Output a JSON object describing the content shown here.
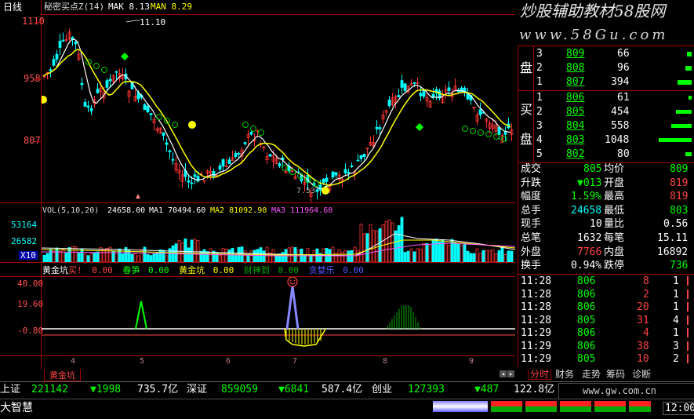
{
  "colors": {
    "up": "#ff3333",
    "down": "#00ffff",
    "bg": "#000000",
    "grid": "#a00000",
    "ma_yellow": "#ffff00",
    "ma_white": "#ffffff"
  },
  "chart_header": {
    "period": "日线",
    "indicator": "秘密买点Z(14)",
    "mak": "MAK 8.13",
    "man": "MAN 8.29"
  },
  "price_axis": [
    "1110",
    "958",
    "807"
  ],
  "high_mark": "11.10",
  "low_mark": "7.53",
  "vol_header": {
    "name": "VOL(5,10,20)",
    "vol": "24658.00",
    "ma1": "MA1 70494.60",
    "ma2": "MA2 81092.90",
    "ma3": "MA3 111964.60"
  },
  "vol_axis": [
    "53164",
    "26582"
  ],
  "vol_unit": "X10",
  "ind_header": {
    "name": "黄金坑",
    "buy": "买!",
    "v1": "0.00",
    "chun": "春笋",
    "v2": "0.00",
    "hjk": "黄金坑",
    "v3": "0.00",
    "caishen": "财神到",
    "v4": "0.00",
    "tan": "贪婪乐",
    "v5": "0.00"
  },
  "ind_axis": [
    "40.00",
    "19.60",
    "-0.80"
  ],
  "months": [
    "4",
    "5",
    "6",
    "7",
    "8",
    "9"
  ],
  "bottom_tab": "黄金坑",
  "watermark_cn": "炒股辅助教材58股网",
  "watermark_url": "www.58Gu.com",
  "order_book": {
    "sell_label": "盘",
    "buy_labels": [
      "买",
      "盘"
    ],
    "asks": [
      {
        "lvl": "3",
        "price": "809",
        "vol": "66"
      },
      {
        "lvl": "2",
        "price": "808",
        "vol": "96"
      },
      {
        "lvl": "1",
        "price": "807",
        "vol": "394"
      }
    ],
    "bids": [
      {
        "lvl": "1",
        "price": "806",
        "vol": "61"
      },
      {
        "lvl": "2",
        "price": "805",
        "vol": "454"
      },
      {
        "lvl": "3",
        "price": "804",
        "vol": "558"
      },
      {
        "lvl": "4",
        "price": "803",
        "vol": "1048"
      },
      {
        "lvl": "5",
        "price": "802",
        "vol": "80"
      }
    ]
  },
  "quote": [
    {
      "l1": "成交",
      "v1": "805",
      "l2": "均价",
      "v2": "809"
    },
    {
      "l1": "升跌",
      "v1": "▼013",
      "l2": "开盘",
      "v2": "819"
    },
    {
      "l1": "幅度",
      "v1": "1.59%",
      "l2": "最高",
      "v2": "819"
    },
    {
      "l1": "总手",
      "v1": "24658",
      "l2": "最低",
      "v2": "803"
    },
    {
      "l1": "现手",
      "v1": "10",
      "l2": "量比",
      "v2": "0.56"
    },
    {
      "l1": "总笔",
      "v1": "1632",
      "l2": "每笔",
      "v2": "15.11"
    },
    {
      "l1": "外盘",
      "v1": "7766",
      "l2": "内盘",
      "v2": "16892"
    },
    {
      "l1": "换手",
      "v1": "0.94%",
      "l2": "跌停",
      "v2": "736"
    }
  ],
  "ticks": [
    {
      "time": "11:28",
      "price": "806",
      "vol": "8",
      "n": "1"
    },
    {
      "time": "11:28",
      "price": "806",
      "vol": "2",
      "n": "1"
    },
    {
      "time": "11:28",
      "price": "806",
      "vol": "20",
      "n": "1"
    },
    {
      "time": "11:28",
      "price": "805",
      "vol": "31",
      "n": "4"
    },
    {
      "time": "11:29",
      "price": "806",
      "vol": "4",
      "n": "1"
    },
    {
      "time": "11:29",
      "price": "806",
      "vol": "38",
      "n": "3"
    },
    {
      "time": "11:29",
      "price": "805",
      "vol": "10",
      "n": "2"
    }
  ],
  "right_tabs": [
    "分时",
    "财务",
    "走势",
    "筹码",
    "诊断"
  ],
  "status_bar": [
    {
      "name": "上证",
      "v1": "221142",
      "chg": "▼1998",
      "amt": "735.7亿"
    },
    {
      "name": "深证",
      "v1": "859059",
      "chg": "▼6841",
      "amt": "587.4亿"
    },
    {
      "name": "创业",
      "v1": "127393",
      "chg": "▼487",
      "amt": "122.8亿"
    }
  ],
  "app_name": "大智慧",
  "site": "www.gw.com.cn",
  "clock": "12:00"
}
